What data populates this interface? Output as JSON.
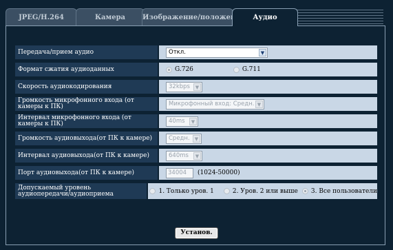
{
  "tabs": [
    {
      "label": "JPEG/H.264",
      "active": false
    },
    {
      "label": "Камера",
      "active": false
    },
    {
      "label": "Изображение/положение",
      "active": false
    },
    {
      "label": "Аудио",
      "active": true
    }
  ],
  "form": {
    "audio_mode": {
      "label": "Передача/прием аудио",
      "value": "Откл."
    },
    "compression": {
      "label": "Формат сжатия аудиоданных",
      "options": [
        "G.726",
        "G.711"
      ],
      "selected": "G.726"
    },
    "bitrate": {
      "label": "Скорость аудиокодирования",
      "value": "32kbps"
    },
    "mic_volume": {
      "label": "Громкость микрофонного входа (от камеры к ПК)",
      "value": "Микрофонный вход: Средн."
    },
    "mic_interval": {
      "label": "Интервал микрофонного входа (от камеры к ПК)",
      "value": "40ms"
    },
    "out_volume": {
      "label": "Громкость аудиовыхода(от ПК к камере)",
      "value": "Средн."
    },
    "out_interval": {
      "label": "Интервал аудиовыхода(от ПК к камере)",
      "value": "640ms"
    },
    "out_port": {
      "label": "Порт аудиовыхода(от ПК к камере)",
      "value": "34004",
      "range": "(1024-50000)"
    },
    "permission": {
      "label": "Допускаемый уровень аудиопередачи/аудиоприема",
      "options": [
        "1. Только уров. 1",
        "2. Уров. 2 или выше",
        "3. Все пользователи"
      ],
      "selected": "3. Все пользователи"
    }
  },
  "buttons": {
    "set": "Установ."
  }
}
